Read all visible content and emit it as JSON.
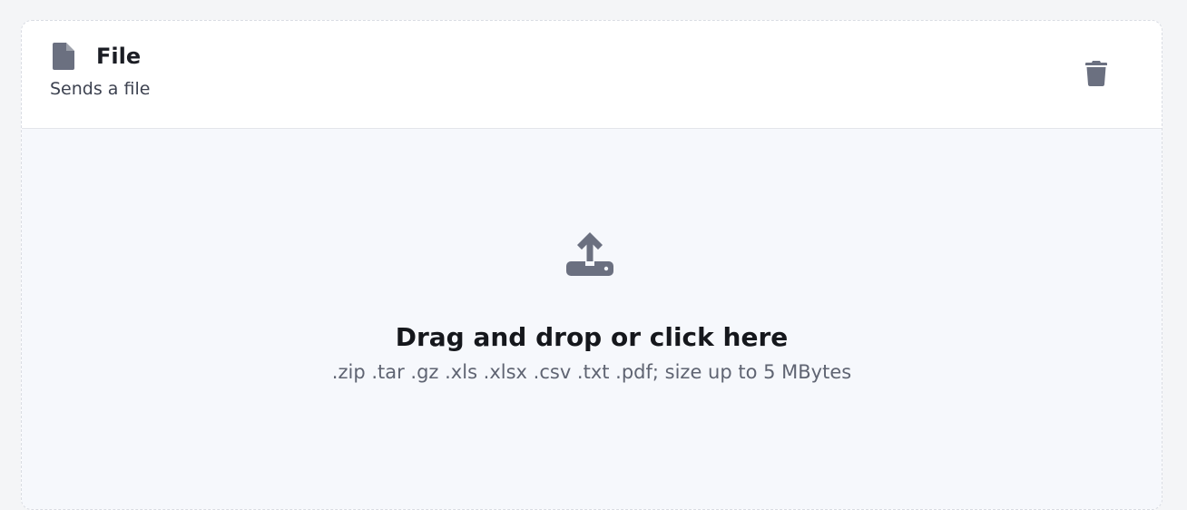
{
  "widget": {
    "icon": "file-icon",
    "title": "File",
    "description": "Sends a file",
    "delete_icon": "trash-icon"
  },
  "dropzone": {
    "icon": "upload-icon",
    "title": "Drag and drop or click here",
    "hint": ".zip .tar .gz .xls .xlsx .csv .txt .pdf; size up to 5 MBytes"
  },
  "colors": {
    "icon": "#6b7080",
    "dropzone_bg": "#f6f8fc",
    "page_bg": "#f4f5f7"
  }
}
